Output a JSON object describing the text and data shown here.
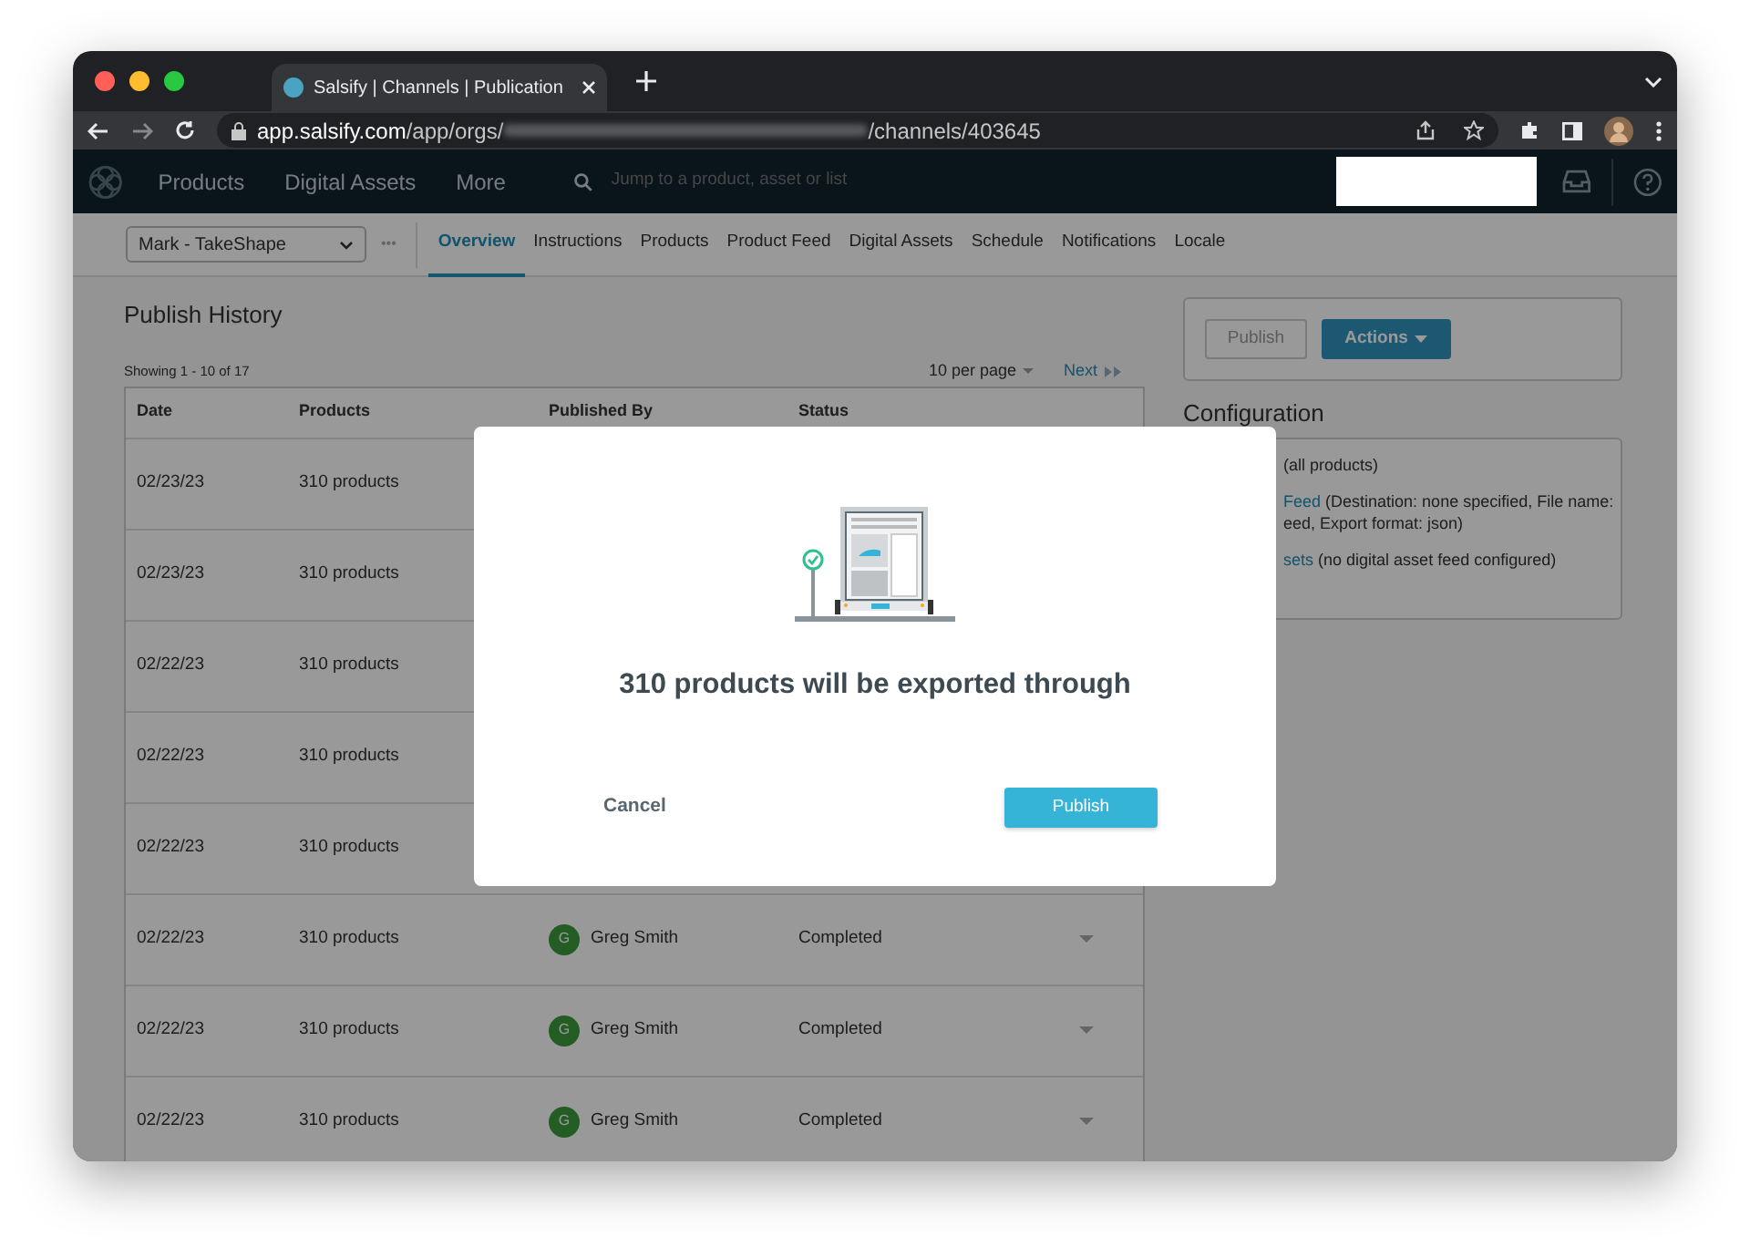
{
  "browser": {
    "tab_title": "Salsify | Channels | Publication",
    "url_host": "app.salsify.com",
    "url_path_start": "/app/orgs/",
    "url_path_end": "/channels/403645"
  },
  "app_nav": {
    "items": [
      "Products",
      "Digital Assets",
      "More"
    ],
    "search": {
      "placeholder": "Jump to a product, asset or list"
    }
  },
  "sub_nav": {
    "channel_select": "Mark - TakeShape",
    "more": "•••",
    "tabs": [
      {
        "label": "Overview",
        "selected": true
      },
      {
        "label": "Instructions",
        "selected": false
      },
      {
        "label": "Products",
        "selected": false
      },
      {
        "label": "Product Feed",
        "selected": false
      },
      {
        "label": "Digital Assets",
        "selected": false
      },
      {
        "label": "Schedule",
        "selected": false
      },
      {
        "label": "Notifications",
        "selected": false
      },
      {
        "label": "Locale",
        "selected": false
      }
    ]
  },
  "publish_history": {
    "title": "Publish History",
    "showing": "Showing 1 - 10 of 17",
    "per_page": "10 per page",
    "next": "Next",
    "columns": [
      "Date",
      "Products",
      "Published By",
      "Status"
    ],
    "rows": [
      {
        "date": "02/23/23",
        "products": "310 products"
      },
      {
        "date": "02/23/23",
        "products": "310 products"
      },
      {
        "date": "02/22/23",
        "products": "310 products"
      },
      {
        "date": "02/22/23",
        "products": "310 products"
      },
      {
        "date": "02/22/23",
        "products": "310 products"
      },
      {
        "date": "02/22/23",
        "products": "310 products",
        "avatar": "G",
        "published_by": "Greg Smith",
        "status": "Completed"
      },
      {
        "date": "02/22/23",
        "products": "310 products",
        "avatar": "G",
        "published_by": "Greg Smith",
        "status": "Completed"
      },
      {
        "date": "02/22/23",
        "products": "310 products",
        "avatar": "G",
        "published_by": "Greg Smith",
        "status": "Completed"
      }
    ]
  },
  "actions": {
    "publish": "Publish",
    "actions": "Actions"
  },
  "configuration": {
    "title": "Configuration",
    "items": [
      {
        "lines": [
          "(all products)"
        ]
      },
      {
        "link": "Feed",
        "lines": [
          "(Destination: none specified, File name:",
          "eed, Export format: json)"
        ]
      },
      {
        "link": "sets",
        "lines": [
          "(no digital asset feed configured)"
        ]
      }
    ]
  },
  "modal": {
    "message": "310 products will be exported through",
    "cancel": "Cancel",
    "publish": "Publish"
  }
}
